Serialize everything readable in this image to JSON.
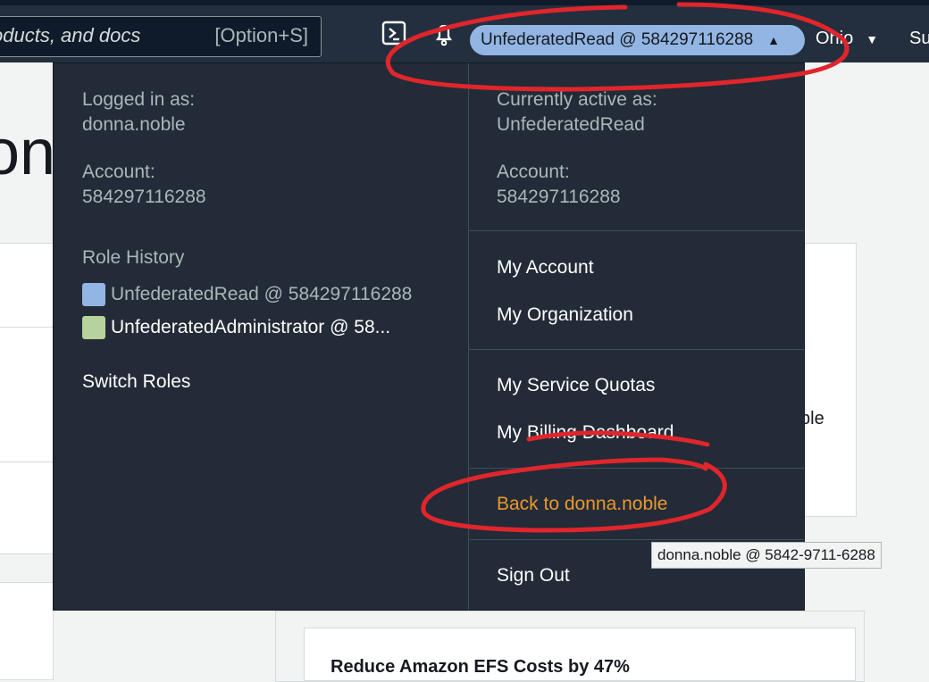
{
  "nav": {
    "search_placeholder": "oducts, and docs",
    "search_shortcut": "[Option+S]",
    "role_pill_label": "UnfederatedRead @ 584297116288",
    "region_label": "Ohio",
    "support_label": "Su"
  },
  "background": {
    "title_fragment": "on",
    "card_text_fragment": "ble",
    "card_heading": "Reduce Amazon EFS Costs by 47%"
  },
  "dropdown": {
    "left": {
      "logged_in_label": "Logged in as:",
      "logged_in_user": "donna.noble",
      "account_label": "Account:",
      "account_id": "584297116288",
      "role_history_label": "Role History",
      "roles": [
        {
          "label": "UnfederatedRead @ 584297116288",
          "color": "#92b5e4"
        },
        {
          "label": "UnfederatedAdministrator @ 58...",
          "color": "#b7d29a"
        }
      ],
      "switch_roles": "Switch Roles"
    },
    "right": {
      "active_label": "Currently active as:",
      "active_role": "UnfederatedRead",
      "account_label": "Account:",
      "account_id": "584297116288",
      "links": {
        "my_account": "My Account",
        "my_organization": "My Organization",
        "my_service_quotas": "My Service Quotas",
        "my_billing_dashboard": "My Billing Dashboard",
        "back_to": "Back to donna.noble",
        "sign_out": "Sign Out"
      }
    }
  },
  "tooltip": "donna.noble @ 5842-9711-6288",
  "colors": {
    "nav_bg": "#232f3e",
    "dropdown_bg": "#222b37",
    "role_pill": "#92b5e4",
    "back_link": "#ec972c",
    "annotation_red": "#e0252c"
  }
}
